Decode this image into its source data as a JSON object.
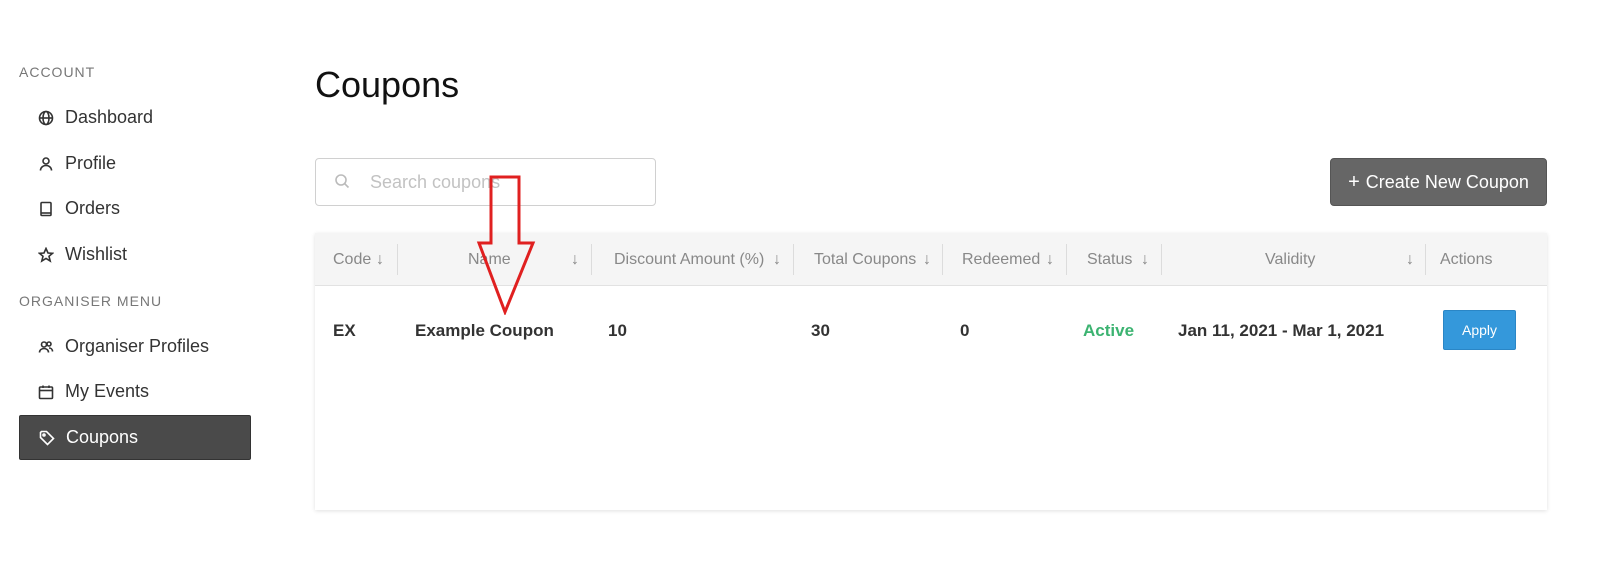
{
  "sidebar": {
    "account_title": "ACCOUNT",
    "organiser_title": "ORGANISER MENU",
    "account_items": [
      {
        "label": "Dashboard",
        "icon": "globe-icon"
      },
      {
        "label": "Profile",
        "icon": "user-icon"
      },
      {
        "label": "Orders",
        "icon": "book-icon"
      },
      {
        "label": "Wishlist",
        "icon": "star-icon"
      }
    ],
    "organiser_items": [
      {
        "label": "Organiser Profiles",
        "icon": "users-icon"
      },
      {
        "label": "My Events",
        "icon": "calendar-icon"
      },
      {
        "label": "Coupons",
        "icon": "tag-icon",
        "active": true
      }
    ]
  },
  "main": {
    "title": "Coupons",
    "search": {
      "placeholder": "Search coupons",
      "value": ""
    },
    "create_button": {
      "label": "Create New Coupon",
      "icon": "plus-icon"
    }
  },
  "table": {
    "columns": [
      "Code",
      "Name",
      "Discount Amount (%)",
      "Total Coupons",
      "Redeemed",
      "Status",
      "Validity",
      "Actions"
    ],
    "rows": [
      {
        "code": "EX",
        "name": "Example Coupon",
        "discount": "10",
        "total": "30",
        "redeemed": "0",
        "status": "Active",
        "validity": "Jan 11, 2021 - Mar 1, 2021",
        "action": "Apply"
      }
    ]
  },
  "colors": {
    "active_nav_bg": "#4a4a4a",
    "create_button_bg": "#666666",
    "apply_button_bg": "#3498db",
    "status_active": "#3cb371",
    "annotation_arrow": "#e02020"
  }
}
